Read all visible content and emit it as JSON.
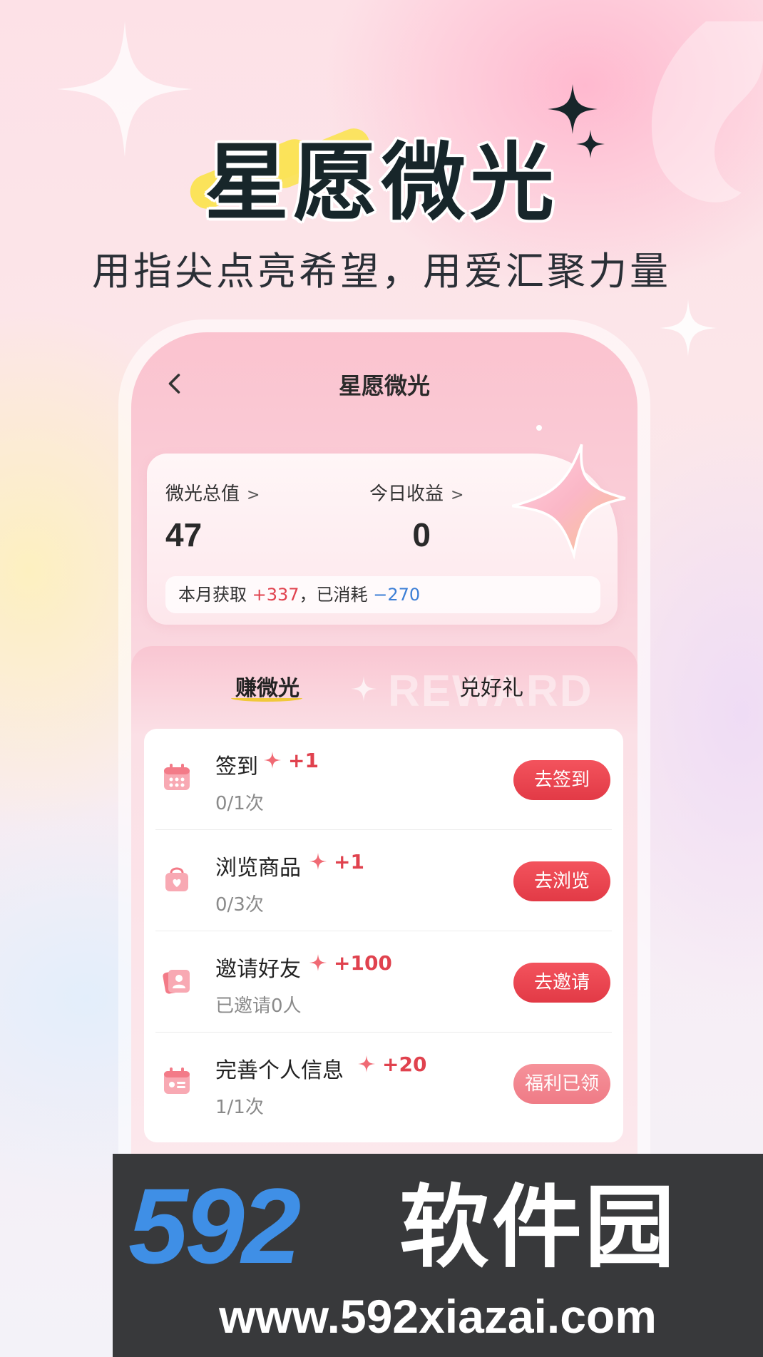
{
  "header": {
    "title": "星愿微光",
    "subtitle": "用指尖点亮希望，用爱汇聚力量"
  },
  "app": {
    "nav_title": "星愿微光",
    "back_icon": "chevron-left-icon",
    "summary": {
      "total_label": "微光总值",
      "total_value": "47",
      "today_label": "今日收益",
      "today_value": "0",
      "month_prefix": "本月获取",
      "month_gain": "+337",
      "month_sep": "，已消耗",
      "month_spent": "−270"
    },
    "tabs": [
      {
        "label": "赚微光",
        "active": true
      },
      {
        "label": "兑好礼",
        "active": false
      }
    ],
    "watermark_text": "REWARD",
    "tasks": [
      {
        "icon": "calendar-icon",
        "title": "签到",
        "reward": "+1",
        "progress": "0/1次",
        "button": "去签到",
        "done": false
      },
      {
        "icon": "shopping-bag-icon",
        "title": "浏览商品",
        "reward": "+1",
        "progress": "0/3次",
        "button": "去浏览",
        "done": false
      },
      {
        "icon": "contact-card-icon",
        "title": "邀请好友",
        "reward": "+100",
        "progress": "已邀请0人",
        "button": "去邀请",
        "done": false
      },
      {
        "icon": "profile-card-icon",
        "title": "完善个人信息",
        "reward": "+20",
        "progress": "1/1次",
        "button": "福利已领",
        "done": true
      }
    ]
  },
  "watermark": {
    "logo_number": "592",
    "logo_text": "软件园",
    "url": "www.592xiazai.com"
  },
  "colors": {
    "accent_red": "#e23a46",
    "gain_red": "#e0424e",
    "spent_blue": "#3c7fd6",
    "title_dark": "#17262a",
    "logo_blue": "#3f8fe6"
  }
}
